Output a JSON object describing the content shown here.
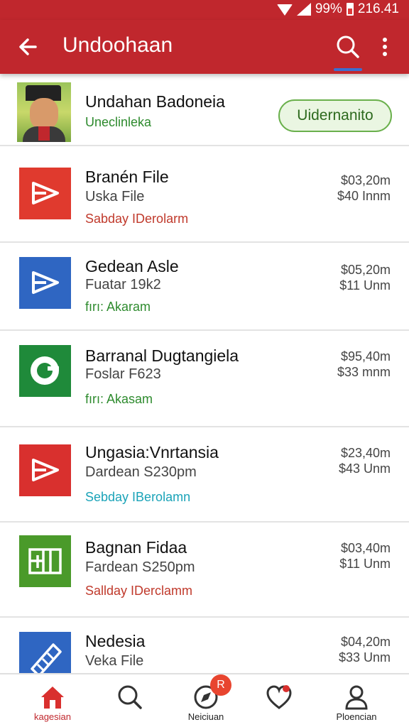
{
  "status_bar": {
    "battery": "99%",
    "time": "216.41"
  },
  "app_bar": {
    "title": "Undoohaan"
  },
  "header_item": {
    "title": "Undahan Badoneia",
    "subtitle": "Uneclinleka",
    "action_label": "Uidernanito"
  },
  "items": [
    {
      "title": "Branén File",
      "subtitle": "Uska File",
      "tag": "Sabday IDerolarm",
      "tag_color": "#c0392b",
      "price_1": "$03,20m",
      "price_2": "$40 Innm",
      "icon": "play-icon",
      "icon_bg": "#e03a2e"
    },
    {
      "title": "Gedean Asle",
      "subtitle": "Fuatar 19k2",
      "tag": "fırı: Akaram",
      "tag_color": "#2e8b2e",
      "price_1": "$05,20m",
      "price_2": "$11 Unm",
      "icon": "play-icon",
      "icon_bg": "#2f66c2"
    },
    {
      "title": "Barranal Dugtangiela",
      "subtitle": "Foslar F623",
      "tag": "fırı: Akasam",
      "tag_color": "#2e8b2e",
      "price_1": "$95,40m",
      "price_2": "$33 mnm",
      "icon": "circle-c-icon",
      "icon_bg": "#1f8a3a"
    },
    {
      "title": "Ungasia:Vnrtansia",
      "subtitle": "Dardean S230pm",
      "tag": "Sebday IBerolamn",
      "tag_color": "#1aa3b8",
      "price_1": "$23,40m",
      "price_2": "$43 Unm",
      "icon": "play-icon",
      "icon_bg": "#d9302e"
    },
    {
      "title": "Bagnan Fidaa",
      "subtitle": "Fardean S250pm",
      "tag": "Sallday IDerclamm",
      "tag_color": "#c0392b",
      "price_1": "$03,40m",
      "price_2": "$11 Unm",
      "icon": "grid-icon",
      "icon_bg": "#4a9a2a"
    },
    {
      "title": "Nedesia",
      "subtitle": "Veka File",
      "tag": "",
      "tag_color": "#c0392b",
      "price_1": "$04,20m",
      "price_2": "$33 Unm",
      "icon": "stapler-icon",
      "icon_bg": "#2f66c2"
    }
  ],
  "bottom_nav": [
    {
      "label": "kagesian",
      "icon": "home-icon",
      "active": true
    },
    {
      "label": "",
      "icon": "search-icon",
      "active": false
    },
    {
      "label": "Neiciuan",
      "icon": "compass-icon",
      "active": false,
      "badge": "R"
    },
    {
      "label": "",
      "icon": "heart-icon",
      "active": false
    },
    {
      "label": "Ploencian",
      "icon": "profile-icon",
      "active": false
    }
  ],
  "colors": {
    "primary": "#c0272d",
    "accent": "#3b6fd0"
  }
}
